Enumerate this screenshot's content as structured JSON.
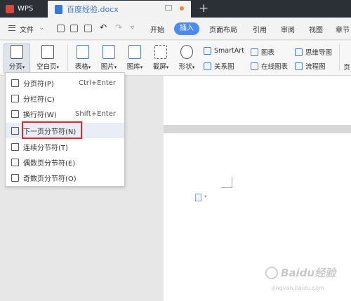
{
  "titlebar": {
    "app_label": "WPS",
    "doc_title": "百度经验.docx",
    "add_tab": "+"
  },
  "menubar": {
    "file": "文件",
    "tabs": [
      "开始",
      "插入",
      "页面布局",
      "引用",
      "审阅",
      "视图",
      "章节"
    ],
    "active_tab": "插入"
  },
  "ribbon": {
    "page_break": "分页",
    "blank_page": "空白页",
    "table": "表格",
    "picture": "图片",
    "gallery": "图库",
    "screenshot": "截屏",
    "shape": "形状",
    "smartart": "SmartArt",
    "chart": "图表",
    "mindmap": "思维导图",
    "relation": "关系图",
    "online_chart": "在线图表",
    "flowchart": "流程图",
    "page_partial": "页"
  },
  "dropdown": {
    "items": [
      {
        "label": "分页符(P)",
        "shortcut": "Ctrl+Enter"
      },
      {
        "label": "分栏符(C)",
        "shortcut": ""
      },
      {
        "label": "换行符(W)",
        "shortcut": "Shift+Enter"
      },
      {
        "label": "下一页分节符(N)",
        "shortcut": ""
      },
      {
        "label": "连续分节符(T)",
        "shortcut": ""
      },
      {
        "label": "偶数页分节符(E)",
        "shortcut": ""
      },
      {
        "label": "奇数页分节符(O)",
        "shortcut": ""
      }
    ],
    "highlighted_index": 3
  },
  "watermark": {
    "brand": "Baidu经验",
    "url": "jingyan.baidu.com"
  },
  "colors": {
    "accent": "#4c8bf5",
    "highlight_box": "#d82a2a",
    "titlebar": "#2b2f36"
  }
}
